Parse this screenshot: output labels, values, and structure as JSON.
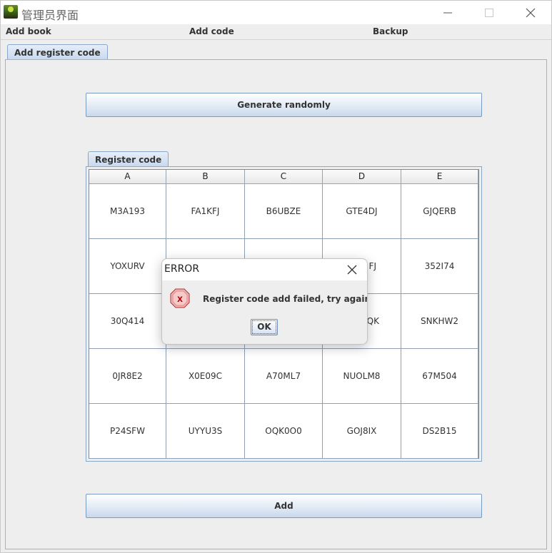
{
  "window": {
    "title": "管理员界面"
  },
  "menu": {
    "items": [
      "Add book",
      "Add code",
      "Backup"
    ]
  },
  "tabs": {
    "main": "Add register code",
    "register": "Register code"
  },
  "buttons": {
    "generate": "Generate randomly",
    "add": "Add"
  },
  "table": {
    "columns": [
      "A",
      "B",
      "C",
      "D",
      "E"
    ],
    "rows": [
      [
        "M3A193",
        "FA1KFJ",
        "B6UBZE",
        "GTE4DJ",
        "GJQERB"
      ],
      [
        "YOXURV",
        "",
        "",
        "FJ",
        "352I74"
      ],
      [
        "30Q414",
        "",
        "",
        "QK",
        "SNKHW2"
      ],
      [
        "0JR8E2",
        "X0E09C",
        "A70ML7",
        "NUOLM8",
        "67M504"
      ],
      [
        "P24SFW",
        "UYYU3S",
        "OQK0O0",
        "GOJ8IX",
        "DS2B15"
      ]
    ]
  },
  "dialog": {
    "title": "ERROR",
    "message": "Register code add failed, try again later",
    "ok_label": "OK",
    "icon": "error-icon"
  },
  "colors": {
    "accent_border": "#7a9cc4",
    "error": "#d9534f"
  }
}
